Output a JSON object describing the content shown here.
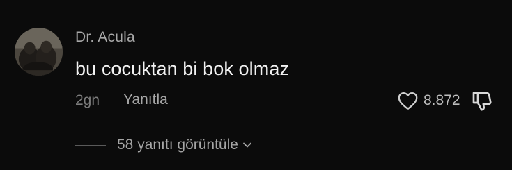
{
  "comment": {
    "username": "Dr. Acula",
    "text": "bu cocuktan bi bok olmaz",
    "age": "2gn",
    "reply_label": "Yanıtla",
    "like_count": "8.872",
    "view_replies_label": "58 yanıtı görüntüle"
  },
  "icons": {
    "like": "heart-outline-icon",
    "dislike": "thumbs-down-icon",
    "expand": "chevron-down-icon"
  },
  "colors": {
    "background": "#0b0b0b",
    "username": "#a8a8a8",
    "body_text": "#f2f2f2",
    "meta_text": "#7d7d7d"
  }
}
